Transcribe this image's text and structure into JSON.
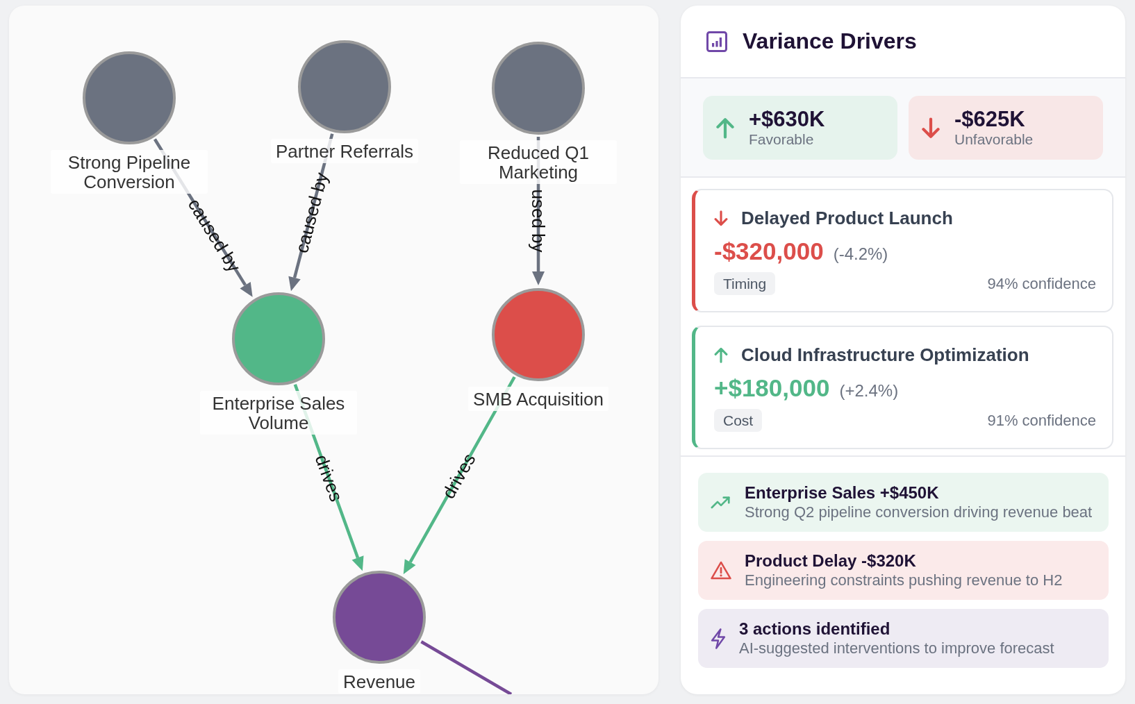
{
  "graph": {
    "nodes": [
      {
        "label": "Strong Pipeline Conversion",
        "color": "#6b7280"
      },
      {
        "label": "Partner Referrals",
        "color": "#6b7280"
      },
      {
        "label": "Reduced Q1 Marketing",
        "color": "#6b7280"
      },
      {
        "label": "Enterprise Sales Volume",
        "color": "#52b788"
      },
      {
        "label": "SMB Acquisition",
        "color": "#dc4e4a"
      },
      {
        "label": "Revenue",
        "color": "#764a96"
      }
    ],
    "edges": [
      {
        "label": "caused by",
        "color": "#6b7280"
      },
      {
        "label": "caused by",
        "color": "#6b7280"
      },
      {
        "label": "used by",
        "color": "#6b7280"
      },
      {
        "label": "drives",
        "color": "#52b788"
      },
      {
        "label": "drives",
        "color": "#52b788"
      },
      {
        "color": "#764a96"
      }
    ]
  },
  "panel": {
    "title": "Variance Drivers",
    "summary": [
      {
        "kind": "favorable",
        "value": "+$630K",
        "label": "Favorable"
      },
      {
        "kind": "unfavorable",
        "value": "-$625K",
        "label": "Unfavorable"
      }
    ],
    "drivers": [
      {
        "kind": "unfavorable",
        "title": "Delayed Product Launch",
        "amount": "-$320,000",
        "percent": "(-4.2%)",
        "tag": "Timing",
        "confidence": "94% confidence"
      },
      {
        "kind": "favorable",
        "title": "Cloud Infrastructure Optimization",
        "amount": "+$180,000",
        "percent": "(+2.4%)",
        "tag": "Cost",
        "confidence": "91% confidence"
      }
    ],
    "insights": [
      {
        "kind": "trend",
        "title": "Enterprise Sales +$450K",
        "text": "Strong Q2 pipeline conversion driving revenue beat"
      },
      {
        "kind": "warning",
        "title": "Product Delay -$320K",
        "text": "Engineering constraints pushing revenue to H2"
      },
      {
        "kind": "action",
        "title": "3 actions identified",
        "text": "AI-suggested interventions to improve forecast"
      }
    ]
  }
}
